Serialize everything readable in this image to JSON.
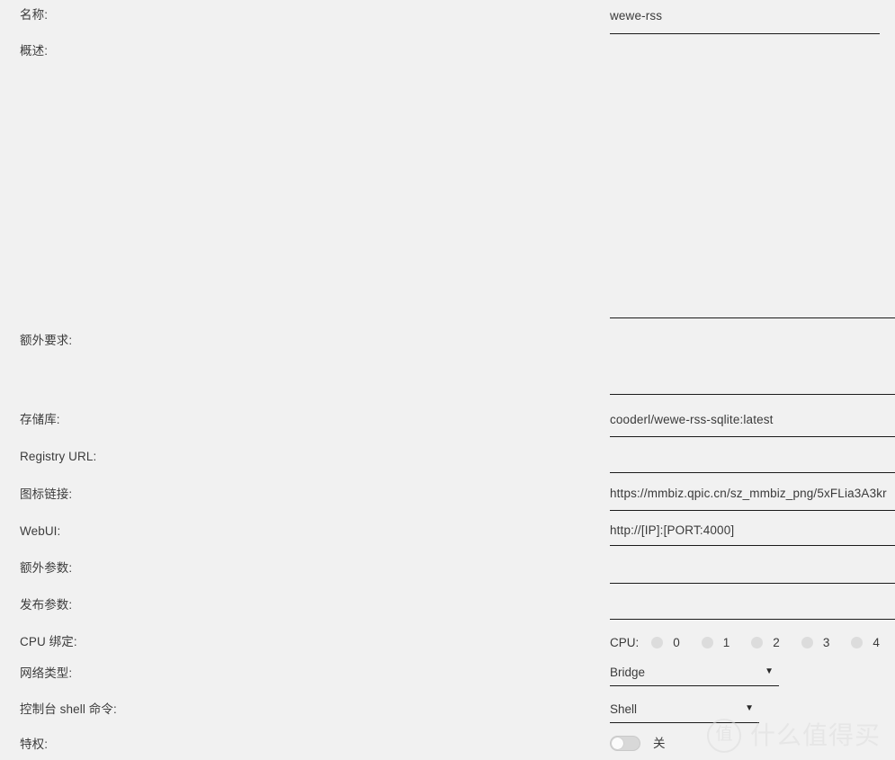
{
  "form": {
    "rows": [
      {
        "label": "名称:",
        "value": "wewe-rss",
        "placeholder": ""
      },
      {
        "label": "概述:",
        "value": "",
        "placeholder": ""
      },
      {
        "label": "额外要求:",
        "value": "",
        "placeholder": ""
      },
      {
        "label": "存储库:",
        "value": "cooderl/wewe-rss-sqlite:latest",
        "placeholder": ""
      },
      {
        "label": "Registry URL:",
        "value": "",
        "placeholder": ""
      },
      {
        "label": "图标链接:",
        "value": "https://mmbiz.qpic.cn/sz_mmbiz_png/5xFLia3A3kr",
        "placeholder": ""
      },
      {
        "label": "WebUI:",
        "value": "http://[IP]:[PORT:4000]",
        "placeholder": ""
      },
      {
        "label": "额外参数:",
        "value": "",
        "placeholder": ""
      },
      {
        "label": "发布参数:",
        "value": "",
        "placeholder": ""
      },
      {
        "label": "CPU 绑定:",
        "value": "",
        "placeholder": ""
      },
      {
        "label": "网络类型:",
        "value": "Bridge",
        "placeholder": ""
      },
      {
        "label": "控制台 shell 命令:",
        "value": "Shell",
        "placeholder": ""
      },
      {
        "label": "特权:",
        "value": "关",
        "placeholder": ""
      }
    ]
  },
  "cpu_binding": {
    "caption": "CPU:",
    "options": [
      {
        "label": "0",
        "selected": false
      },
      {
        "label": "1",
        "selected": false
      },
      {
        "label": "2",
        "selected": false
      },
      {
        "label": "3",
        "selected": false
      },
      {
        "label": "4",
        "selected": false
      }
    ]
  },
  "network_type": {
    "selected": "Bridge",
    "caret": "▼"
  },
  "console_shell": {
    "selected": "Shell",
    "caret": "▼"
  },
  "privileged": {
    "state_label": "关",
    "on": false
  },
  "watermark": {
    "badge": "值",
    "text": "什么值得买"
  },
  "colors": {
    "background": "#f1f1f1",
    "text": "#3a3a3a",
    "rule": "#1b1b1b",
    "radio": "#dcdcdc",
    "watermark": "#dedede"
  }
}
